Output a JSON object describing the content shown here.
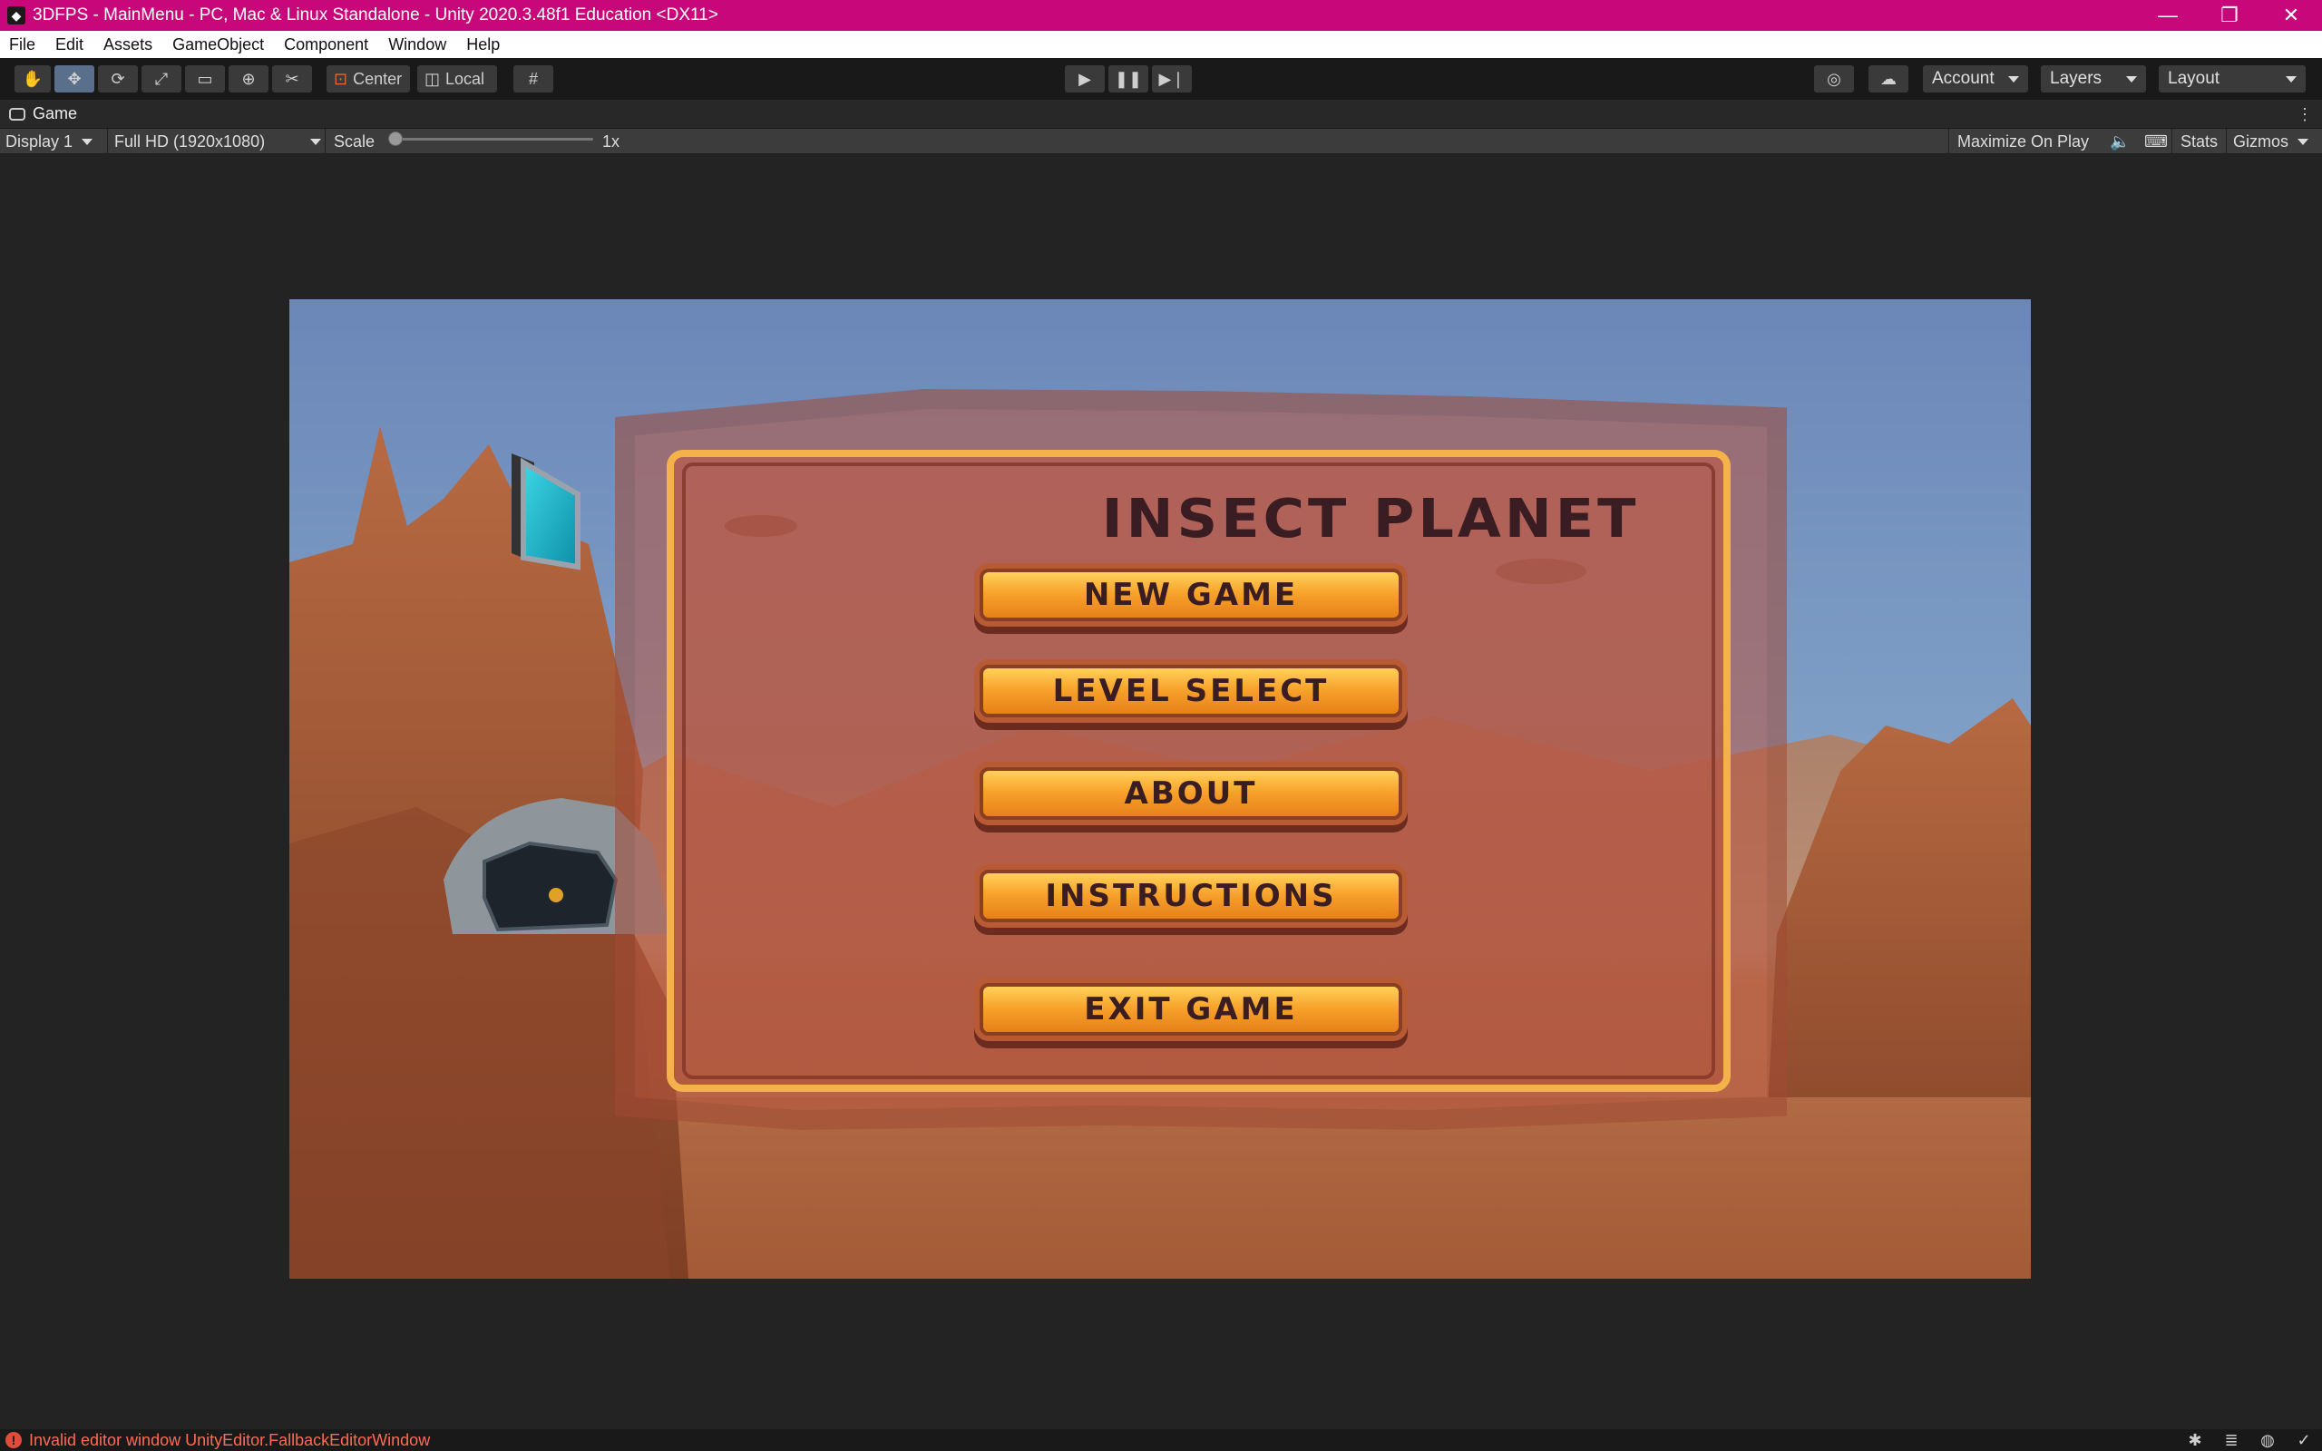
{
  "window": {
    "title": "3DFPS - MainMenu - PC, Mac & Linux Standalone - Unity 2020.3.48f1 Education <DX11>",
    "titlebar_color": "#c8077a"
  },
  "menu": [
    "File",
    "Edit",
    "Assets",
    "GameObject",
    "Component",
    "Window",
    "Help"
  ],
  "toolbar": {
    "pivot": "Center",
    "space": "Local",
    "account": "Account",
    "layers": "Layers",
    "layout": "Layout"
  },
  "game_tab": {
    "label": "Game"
  },
  "game_bar": {
    "display": "Display 1",
    "resolution": "Full HD (1920x1080)",
    "scale_label": "Scale",
    "scale_value": "1x",
    "scale_level": 0.0,
    "maximize": "Maximize On Play",
    "stats": "Stats",
    "gizmos": "Gizmos"
  },
  "game_ui": {
    "title": "INSECT PLANET",
    "buttons": [
      "NEW GAME",
      "LEVEL SELECT",
      "ABOUT",
      "INSTRUCTIONS",
      "EXIT GAME"
    ]
  },
  "status": {
    "message": "Invalid editor window UnityEditor.FallbackEditorWindow",
    "message_color": "#ff6a55"
  }
}
